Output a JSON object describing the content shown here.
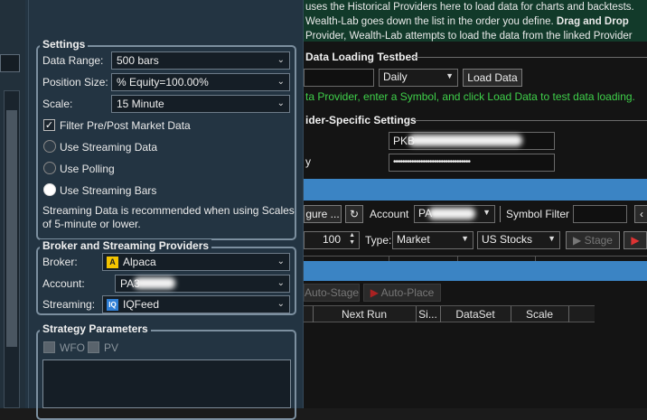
{
  "bg": {
    "intro_line1": "uses the Historical Providers here to load data for charts and backtests.",
    "intro_line2_a": "Wealth-Lab goes down the list in the order you define.",
    "intro_line2_b": "Drag and Drop",
    "intro_line3": "Provider, Wealth-Lab attempts to load the data from the linked Provider",
    "testbed_title": "Data Loading Testbed",
    "testbed_scale": "Daily",
    "load_data_label": "Load Data",
    "testbed_hint": "ta Provider, enter a Symbol, and click Load Data to test data loading.",
    "provider_settings_title": "ider-Specific Settings",
    "key_prefix": "PKB",
    "secret_mask": "••••••••••••••••••••••••••••••••••",
    "letter_y": "y",
    "configure_label": "gure ...",
    "account_label": "Account",
    "account_prefix": "PA",
    "symbol_filter_label": "Symbol Filter",
    "qty_value": "100",
    "type_label": "Type:",
    "type_value": "Market",
    "market_value": "US Stocks",
    "stage_label": "Stage",
    "auto_stage_label": "Auto-Stage",
    "auto_place_label": "Auto-Place",
    "columns": [
      "Next Run",
      "Si...",
      "DataSet",
      "Scale"
    ]
  },
  "panel": {
    "settings_title": "Settings",
    "data_range_label": "Data Range:",
    "data_range_value": "500 bars",
    "position_size_label": "Position Size:",
    "position_size_value": "% Equity=100.00%",
    "scale_label": "Scale:",
    "scale_value": "15 Minute",
    "filter_label": "Filter Pre/Post Market Data",
    "streaming_data_label": "Use Streaming Data",
    "polling_label": "Use Polling",
    "streaming_bars_label": "Use Streaming Bars",
    "note_line1": "Streaming Data is recommended when using Scales",
    "note_line2": "of 5-minute or lower.",
    "broker_title": "Broker and Streaming Providers",
    "broker_label": "Broker:",
    "broker_value": "Alpaca",
    "account_label": "Account:",
    "account_prefix": "PA3",
    "streaming_label": "Streaming:",
    "streaming_value": "IQFeed",
    "strategy_title": "Strategy Parameters",
    "wfo_label": "WFO",
    "pv_label": "PV"
  },
  "colors": {
    "panel_bg": "#233442",
    "accent_blue": "#3b84c4",
    "hint_green": "#3fd04a",
    "intro_bg": "#123a2a"
  },
  "icons": [
    "chevron-down-icon",
    "check-icon",
    "alpaca-logo-icon",
    "iqfeed-logo-icon",
    "refresh-icon",
    "play-icon",
    "stop-icon"
  ]
}
